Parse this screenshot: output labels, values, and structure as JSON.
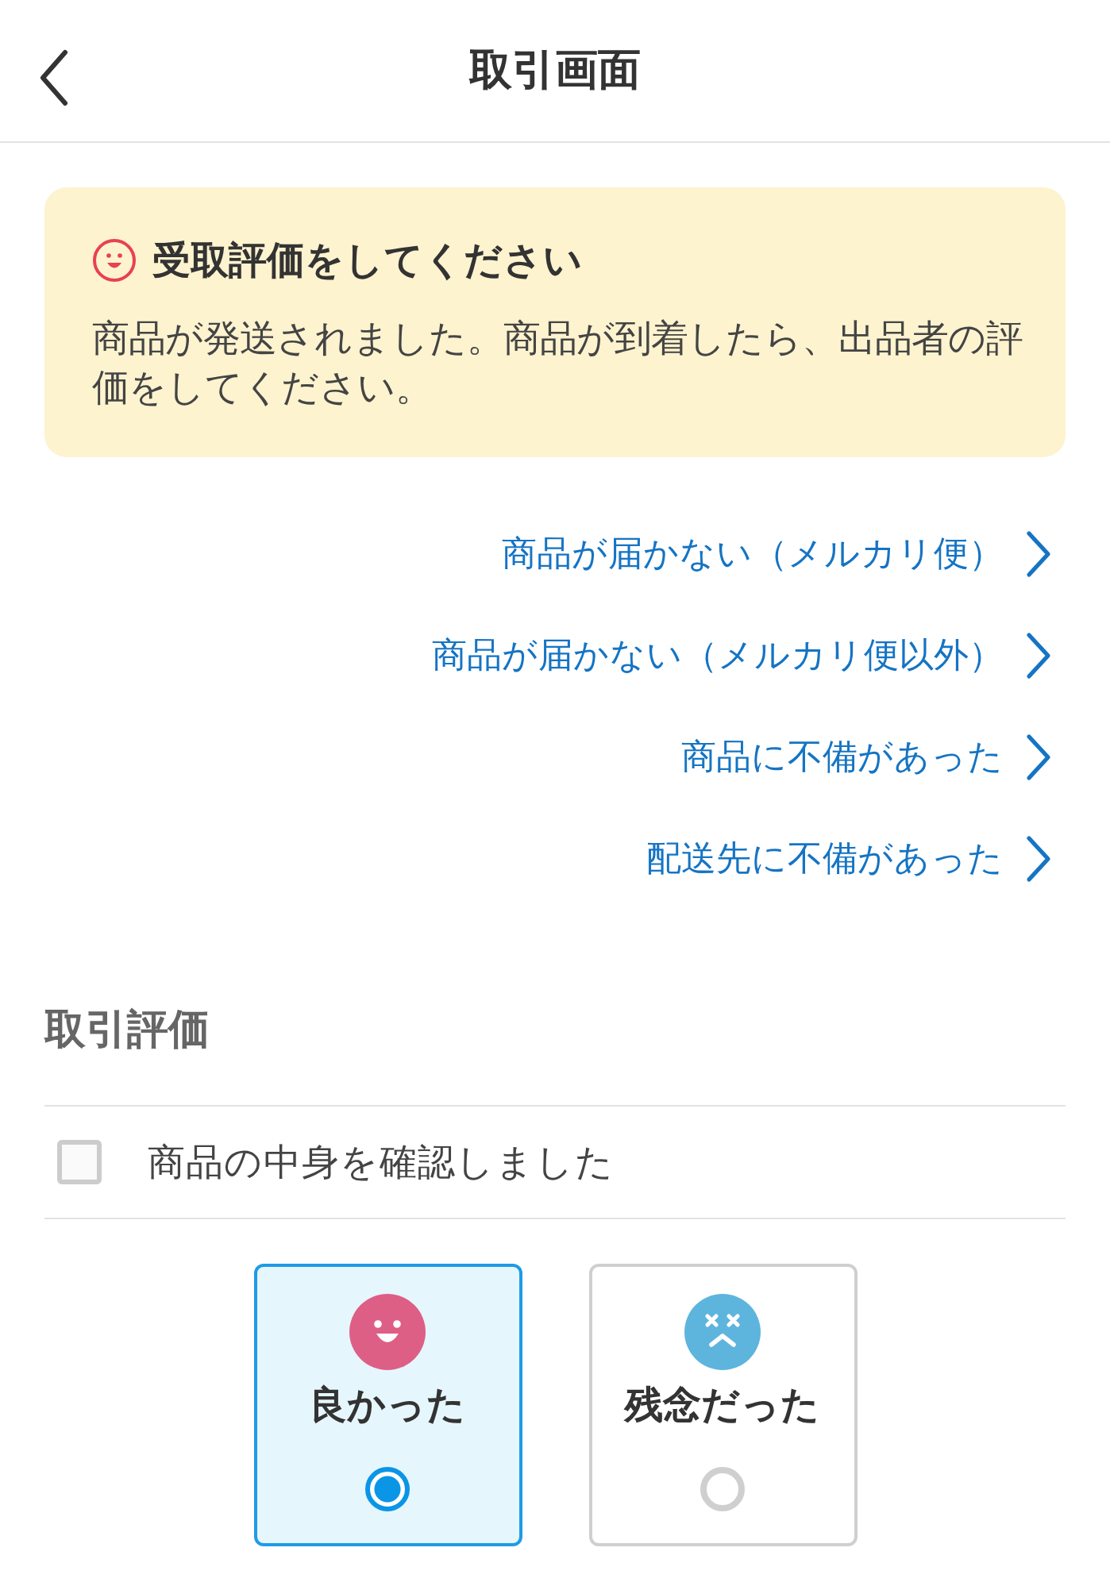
{
  "header": {
    "title": "取引画面"
  },
  "notice": {
    "title": "受取評価をしてください",
    "body": "商品が発送されました。商品が到着したら、出品者の評価をしてください。"
  },
  "links": [
    {
      "label": "商品が届かない（メルカリ便）"
    },
    {
      "label": "商品が届かない（メルカリ便以外）"
    },
    {
      "label": "商品に不備があった"
    },
    {
      "label": "配送先に不備があった"
    }
  ],
  "rating": {
    "title": "取引評価",
    "confirm": {
      "label": "商品の中身を確認しました",
      "checked": false
    },
    "options": [
      {
        "kind": "good",
        "label": "良かった",
        "selected": true
      },
      {
        "kind": "bad",
        "label": "残念だった",
        "selected": false
      }
    ]
  }
}
